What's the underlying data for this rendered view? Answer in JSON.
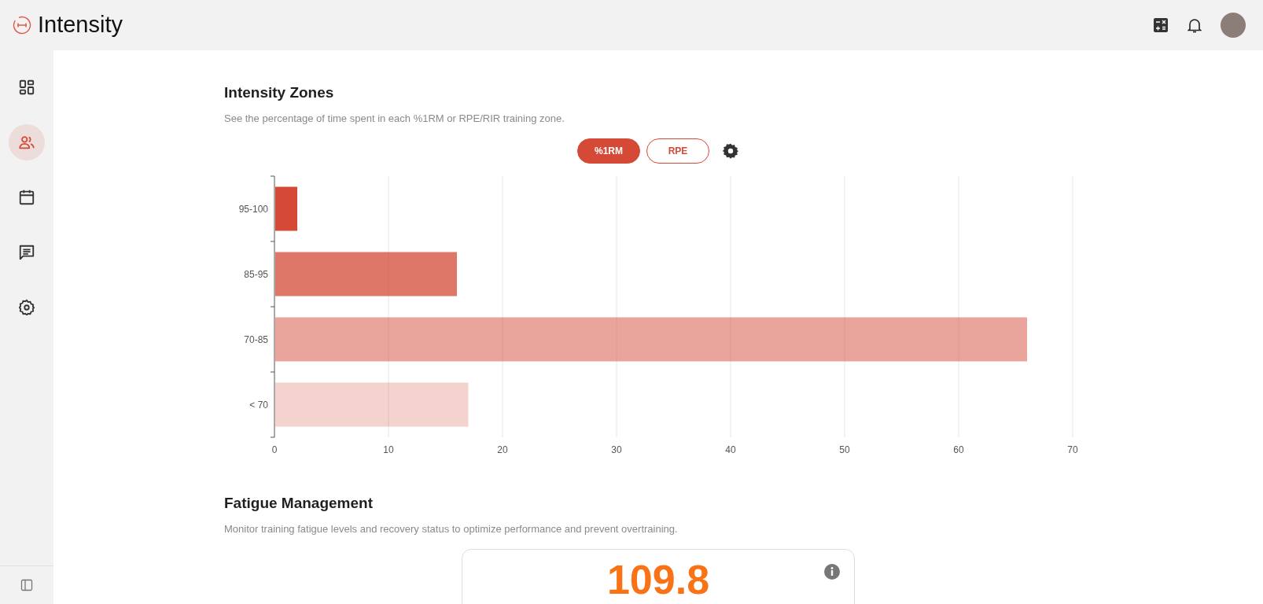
{
  "app": {
    "title": "Intensity"
  },
  "sidebar": {
    "items": [
      {
        "kind": "dashboard",
        "selected": false
      },
      {
        "kind": "users",
        "selected": true
      },
      {
        "kind": "calendar",
        "selected": false
      },
      {
        "kind": "chat",
        "selected": false
      },
      {
        "kind": "settings",
        "selected": false
      }
    ]
  },
  "intensity_zones": {
    "title": "Intensity Zones",
    "subtitle": "See the percentage of time spent in each %1RM or RPE/RIR training zone.",
    "toggle": [
      {
        "label": "%1RM",
        "selected": true
      },
      {
        "label": "RPE",
        "selected": false
      }
    ],
    "chart_data": {
      "type": "bar",
      "orientation": "horizontal",
      "categories": [
        "95-100",
        "85-95",
        "70-85",
        "< 70"
      ],
      "series": [
        {
          "color": "#d44a37",
          "values": [
            2,
            16,
            66,
            17
          ]
        }
      ],
      "grid": true,
      "xlim": [
        0,
        70
      ],
      "xticks": [
        0,
        10,
        20,
        30,
        40,
        50,
        60,
        70
      ]
    }
  },
  "fatigue_management": {
    "title": "Fatigue Management",
    "subtitle": "Monitor training fatigue levels and recovery status to optimize performance and prevent overtraining.",
    "value": "109.8"
  }
}
